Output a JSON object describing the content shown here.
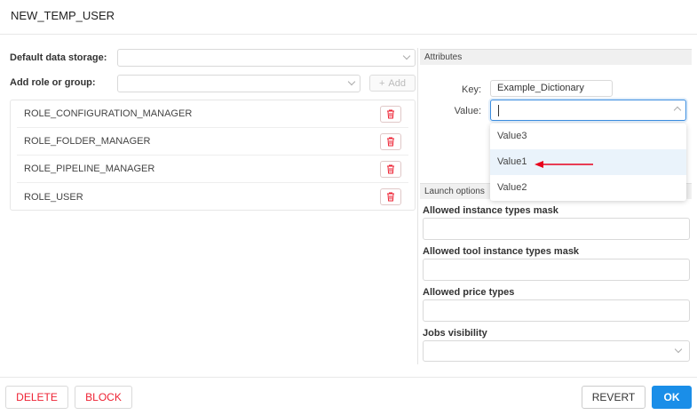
{
  "title": "NEW_TEMP_USER",
  "left": {
    "default_storage_label": "Default data storage:",
    "default_storage_value": "",
    "add_role_label": "Add role or group:",
    "add_role_value": "",
    "add_button_label": "Add",
    "roles": [
      "ROLE_CONFIGURATION_MANAGER",
      "ROLE_FOLDER_MANAGER",
      "ROLE_PIPELINE_MANAGER",
      "ROLE_USER"
    ]
  },
  "attributes": {
    "header": "Attributes",
    "key_label": "Key:",
    "key_value": "Example_Dictionary",
    "value_label": "Value:",
    "value_input": "",
    "dropdown_options": [
      "Value3",
      "Value1",
      "Value2"
    ],
    "dropdown_highlighted": "Value1"
  },
  "launch_options": {
    "header": "Launch options",
    "fields": [
      {
        "label": "Allowed instance types mask",
        "value": ""
      },
      {
        "label": "Allowed tool instance types mask",
        "value": ""
      },
      {
        "label": "Allowed price types",
        "value": ""
      },
      {
        "label": "Jobs visibility",
        "value": ""
      }
    ]
  },
  "footer": {
    "delete_label": "DELETE",
    "block_label": "BLOCK",
    "revert_label": "REVERT",
    "ok_label": "OK"
  },
  "colors": {
    "accent": "#1a8ee8",
    "danger": "#e22233",
    "annotation_arrow": "#e8001c"
  }
}
